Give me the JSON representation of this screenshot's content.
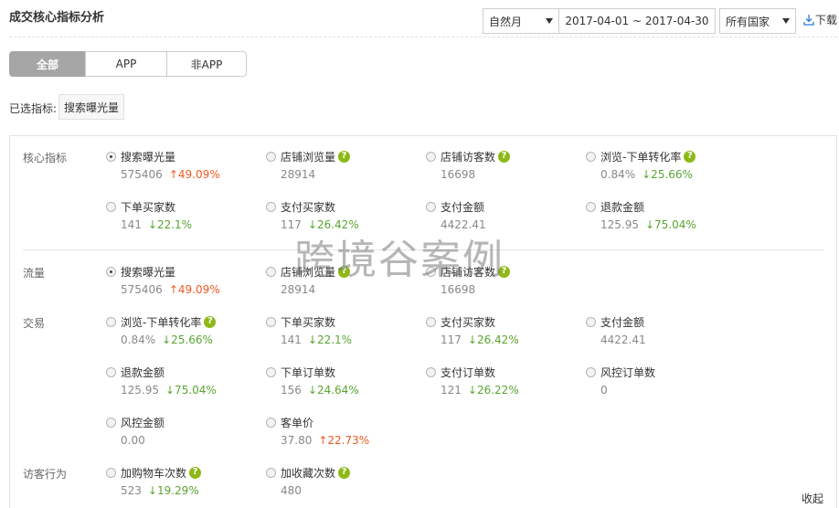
{
  "header": {
    "title": "成交核心指标分析",
    "period": "自然月",
    "date_range": "2017-04-01 ~ 2017-04-30",
    "country": "所有国家",
    "download": "下载"
  },
  "tabs": [
    {
      "label": "全部",
      "active": true
    },
    {
      "label": "APP",
      "active": false
    },
    {
      "label": "非APP",
      "active": false
    }
  ],
  "selected": {
    "label": "已选指标:",
    "chip": "搜索曝光量"
  },
  "groups": {
    "core": "核心指标",
    "traffic": "流量",
    "trade": "交易",
    "visitor": "访客行为"
  },
  "metrics": {
    "core": [
      {
        "name": "搜索曝光量",
        "value": "575406",
        "change": "↑49.09%",
        "dir": "up",
        "checked": true
      },
      {
        "name": "店铺浏览量",
        "value": "28914",
        "help": "?"
      },
      {
        "name": "店铺访客数",
        "value": "16698",
        "help": "?"
      },
      {
        "name": "浏览-下单转化率",
        "value": "0.84%",
        "change": "↓25.66%",
        "dir": "down",
        "help": "?"
      },
      {
        "name": "下单买家数",
        "value": "141",
        "change": "↓22.1%",
        "dir": "down"
      },
      {
        "name": "支付买家数",
        "value": "117",
        "change": "↓26.42%",
        "dir": "down"
      },
      {
        "name": "支付金额",
        "value": "4422.41"
      },
      {
        "name": "退款金额",
        "value": "125.95",
        "change": "↓75.04%",
        "dir": "down"
      }
    ],
    "traffic": [
      {
        "name": "搜索曝光量",
        "value": "575406",
        "change": "↑49.09%",
        "dir": "up",
        "checked": true
      },
      {
        "name": "店铺浏览量",
        "value": "28914",
        "help": "?"
      },
      {
        "name": "店铺访客数",
        "value": "16698",
        "help": "?"
      }
    ],
    "trade": [
      {
        "name": "浏览-下单转化率",
        "value": "0.84%",
        "change": "↓25.66%",
        "dir": "down",
        "help": "?"
      },
      {
        "name": "下单买家数",
        "value": "141",
        "change": "↓22.1%",
        "dir": "down"
      },
      {
        "name": "支付买家数",
        "value": "117",
        "change": "↓26.42%",
        "dir": "down"
      },
      {
        "name": "支付金额",
        "value": "4422.41"
      },
      {
        "name": "退款金额",
        "value": "125.95",
        "change": "↓75.04%",
        "dir": "down"
      },
      {
        "name": "下单订单数",
        "value": "156",
        "change": "↓24.64%",
        "dir": "down"
      },
      {
        "name": "支付订单数",
        "value": "121",
        "change": "↓26.22%",
        "dir": "down"
      },
      {
        "name": "风控订单数",
        "value": "0"
      },
      {
        "name": "风控金额",
        "value": "0.00"
      },
      {
        "name": "客单价",
        "value": "37.80",
        "change": "↑22.73%",
        "dir": "up"
      }
    ],
    "visitor": [
      {
        "name": "加购物车次数",
        "value": "523",
        "change": "↓19.29%",
        "dir": "down",
        "help": "?"
      },
      {
        "name": "加收藏次数",
        "value": "480",
        "help": "?"
      }
    ]
  },
  "watermark": "跨境谷案例",
  "collapse": "收起",
  "colors": {
    "up": "#f05a23",
    "down": "#5aa531",
    "help_badge": "#8cb918",
    "active_tab": "#a6a6a6"
  }
}
